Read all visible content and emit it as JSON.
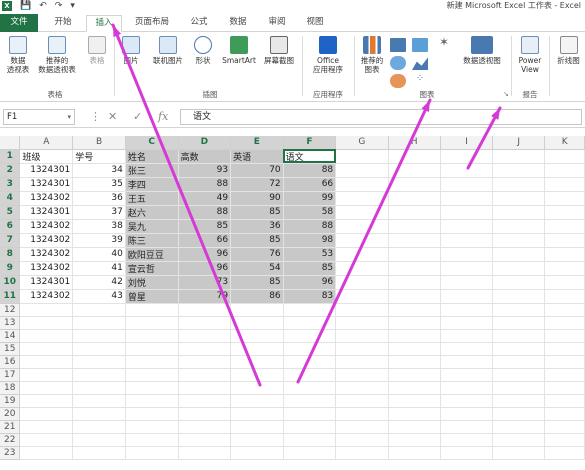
{
  "title_bar": {
    "logo": "X",
    "window_title": "新建 Microsoft Excel 工作表 - Excel"
  },
  "tabs": [
    "文件",
    "开始",
    "插入",
    "页面布局",
    "公式",
    "数据",
    "审阅",
    "视图"
  ],
  "ribbon": {
    "buttons": {
      "pivot_table": "数据\n透视表",
      "recommended_pivot": "推荐的\n数据透视表",
      "table": "表格",
      "picture": "图片",
      "online_picture": "联机图片",
      "shapes": "形状",
      "smartart": "SmartArt",
      "screenshot": "屏幕截图",
      "office_apps": "Office\n应用程序",
      "recommended_charts": "推荐的\n图表",
      "pivot_chart": "数据透视图",
      "power_view": "Power\nView",
      "sparkline_line": "折线图"
    },
    "groups": {
      "tables": "表格",
      "illustrations": "插图",
      "apps": "应用程序",
      "charts": "图表",
      "reports": "报告"
    }
  },
  "formula_bar": {
    "name_box": "F1",
    "formula": "语文"
  },
  "sheet": {
    "columns": [
      "A",
      "B",
      "C",
      "D",
      "E",
      "F",
      "G",
      "H",
      "I",
      "J",
      "K"
    ],
    "row_numbers": [
      "1",
      "2",
      "3",
      "4",
      "5",
      "6",
      "7",
      "8",
      "9",
      "10",
      "11",
      "12",
      "13",
      "14",
      "15",
      "16",
      "17",
      "18",
      "19",
      "20",
      "21",
      "22",
      "23"
    ],
    "headers": [
      "班级",
      "学号",
      "姓名",
      "高数",
      "英语",
      "语文"
    ],
    "rows": [
      [
        "1324301",
        "34",
        "张三",
        "93",
        "70",
        "88"
      ],
      [
        "1324301",
        "35",
        "李四",
        "88",
        "72",
        "66"
      ],
      [
        "1324302",
        "36",
        "王五",
        "49",
        "90",
        "99"
      ],
      [
        "1324301",
        "37",
        "赵六",
        "88",
        "85",
        "58"
      ],
      [
        "1324302",
        "38",
        "吴九",
        "85",
        "36",
        "88"
      ],
      [
        "1324302",
        "39",
        "陈三",
        "66",
        "85",
        "98"
      ],
      [
        "1324302",
        "40",
        "欧阳豆豆",
        "96",
        "76",
        "53"
      ],
      [
        "1324302",
        "41",
        "宣云哲",
        "96",
        "54",
        "85"
      ],
      [
        "1324301",
        "42",
        "刘悦",
        "73",
        "85",
        "96"
      ],
      [
        "1324302",
        "43",
        "曾星",
        "79",
        "86",
        "83"
      ]
    ]
  },
  "accent": "#217346",
  "arrow_color": "#d63ad6"
}
